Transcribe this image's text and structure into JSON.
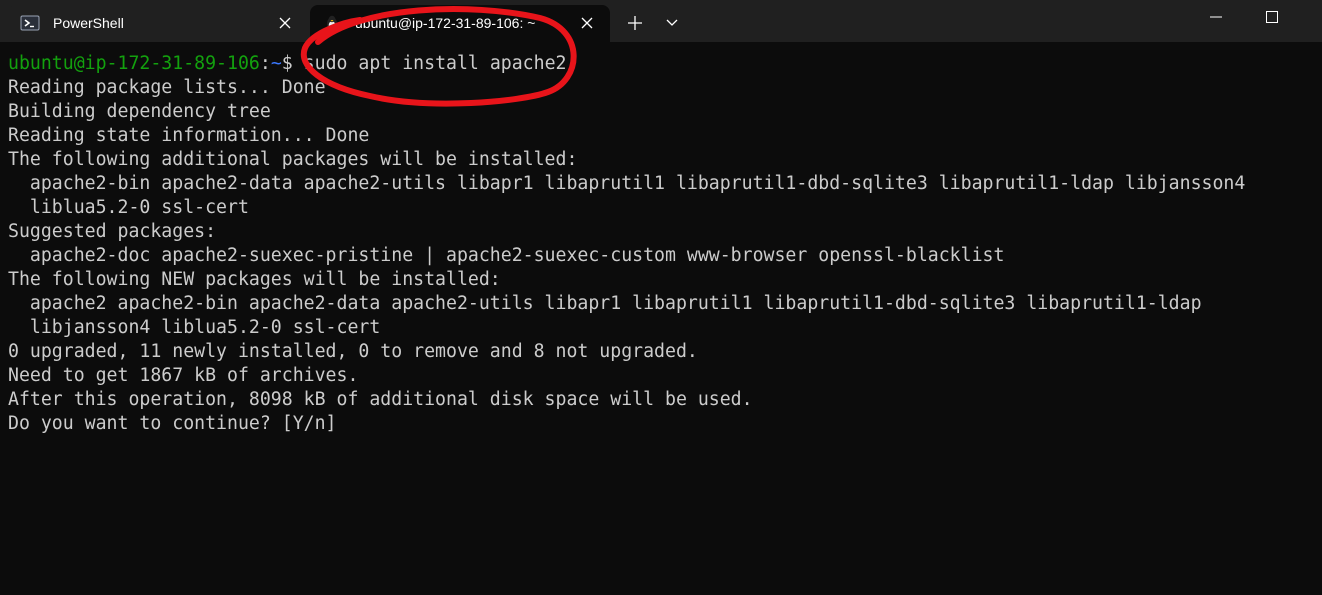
{
  "tabs": [
    {
      "label": "PowerShell",
      "icon": "powershell-icon",
      "active": false
    },
    {
      "label": "ubuntu@ip-172-31-89-106: ~",
      "icon": "linux-penguin-icon",
      "active": true
    }
  ],
  "colors": {
    "prompt_user": "#13a10e",
    "prompt_path": "#3b78ff",
    "terminal_text": "#cccccc",
    "terminal_bg": "#0c0c0c",
    "annotation": "#e8141a"
  },
  "prompt": {
    "user_host": "ubuntu@ip-172-31-89-106",
    "colon": ":",
    "path": "~",
    "symbol": "$ ",
    "command": "sudo apt install apache2"
  },
  "output": [
    "Reading package lists... Done",
    "Building dependency tree",
    "Reading state information... Done",
    "The following additional packages will be installed:",
    "  apache2-bin apache2-data apache2-utils libapr1 libaprutil1 libaprutil1-dbd-sqlite3 libaprutil1-ldap libjansson4",
    "  liblua5.2-0 ssl-cert",
    "Suggested packages:",
    "  apache2-doc apache2-suexec-pristine | apache2-suexec-custom www-browser openssl-blacklist",
    "The following NEW packages will be installed:",
    "  apache2 apache2-bin apache2-data apache2-utils libapr1 libaprutil1 libaprutil1-dbd-sqlite3 libaprutil1-ldap",
    "  libjansson4 liblua5.2-0 ssl-cert",
    "0 upgraded, 11 newly installed, 0 to remove and 8 not upgraded.",
    "Need to get 1867 kB of archives.",
    "After this operation, 8098 kB of additional disk space will be used.",
    "Do you want to continue? [Y/n]"
  ]
}
